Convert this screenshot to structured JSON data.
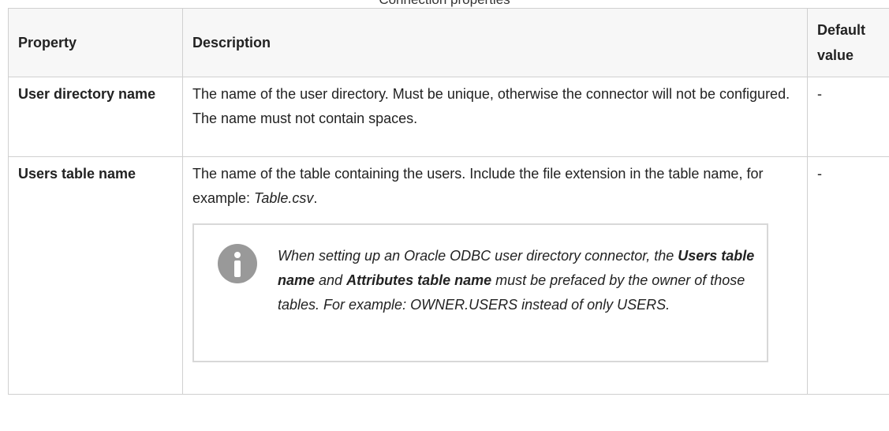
{
  "caption": "Connection properties",
  "headers": {
    "property": "Property",
    "description": "Description",
    "default": "Default value"
  },
  "rows": [
    {
      "property": "User directory name",
      "description": "The name of the user directory. Must be unique, otherwise the connector will not be configured. The name must not contain spaces.",
      "default": "-"
    },
    {
      "property": "Users table name",
      "description_pre": "The name of the table containing the users. Include the file extension in the table name, for example: ",
      "description_example": "Table.csv",
      "description_post": ".",
      "default": "-",
      "note": {
        "icon": "info-icon",
        "part1": "When setting up an Oracle ODBC user directory connector, the ",
        "bold1": "Users table name",
        "part2": " and ",
        "bold2": "Attributes table name",
        "part3": " must be prefaced by the owner of those tables. For example: OWNER.USERS instead of only USERS."
      }
    }
  ]
}
